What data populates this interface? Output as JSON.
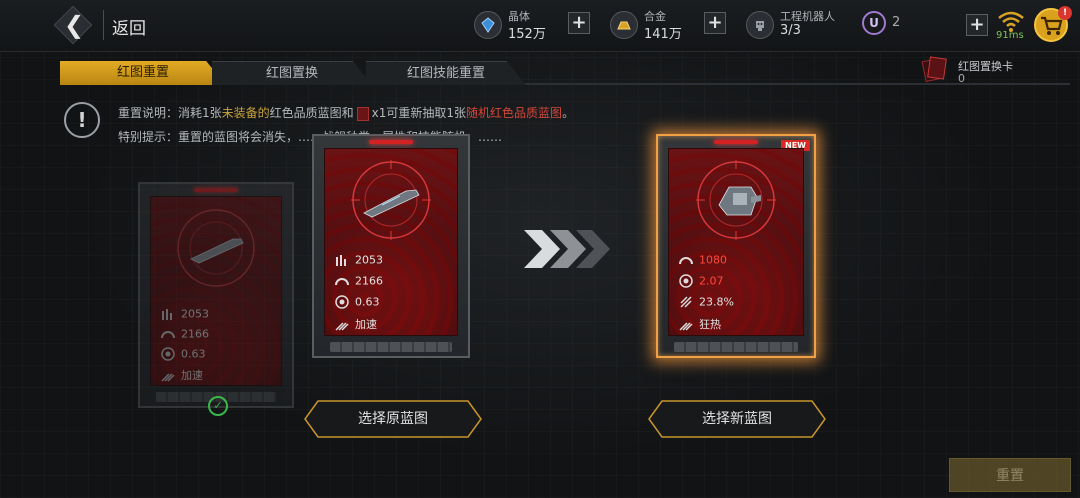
{
  "header": {
    "back_label": "返回",
    "resources": [
      {
        "name": "晶体",
        "value": "152万",
        "icon": "crystal-icon"
      },
      {
        "name": "合金",
        "value": "141万",
        "icon": "alloy-icon"
      },
      {
        "name": "工程机器人",
        "value": "3/3",
        "icon": "robot-icon"
      }
    ],
    "u_badge": "U",
    "u_count": "2",
    "ping": "91ms",
    "cart_badge": "!"
  },
  "tabs": [
    {
      "label": "红图重置",
      "active": true
    },
    {
      "label": "红图置换",
      "active": false
    },
    {
      "label": "红图技能重置",
      "active": false
    }
  ],
  "reset_card": {
    "name": "红图置换卡",
    "count": "0"
  },
  "notice": {
    "line1_a": "重置说明：消耗1张",
    "line1_hl": "未装备的",
    "line1_b": "红色品质蓝图和",
    "line1_c": "x1可重新抽取1张",
    "line1_red": "随机红色品质蓝图",
    "line1_end": "。",
    "line2": "特别提示：重置的蓝图将会消失，……战舰种类、属性和技能随机，……"
  },
  "cards": {
    "faded": {
      "stats": [
        "2053",
        "2166",
        "0.63",
        "加速"
      ]
    },
    "original": {
      "stats": [
        "2053",
        "2166",
        "0.63",
        "加速"
      ]
    },
    "new": {
      "badge": "NEW",
      "stats": [
        "1080",
        "2.07",
        "23.8%",
        "狂热"
      ]
    }
  },
  "buttons": {
    "select_original": "选择原蓝图",
    "select_new": "选择新蓝图",
    "reset": "重置"
  },
  "colors": {
    "accent": "#d8a325",
    "red": "#d32222",
    "glow": "#f2a044"
  }
}
